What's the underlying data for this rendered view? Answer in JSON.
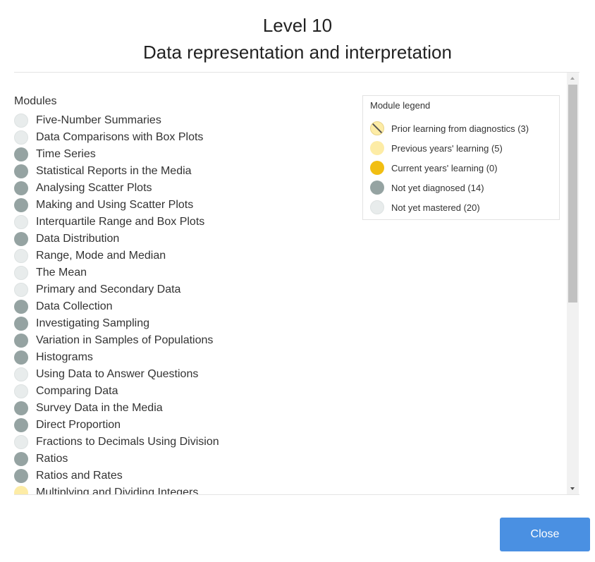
{
  "header": {
    "level_title": "Level 10",
    "subtitle": "Data representation and interpretation"
  },
  "modules": {
    "heading": "Modules",
    "items": [
      {
        "label": "Five-Number Summaries",
        "status": "not-mastered"
      },
      {
        "label": "Data Comparisons with Box Plots",
        "status": "not-mastered"
      },
      {
        "label": "Time Series",
        "status": "not-diagnosed"
      },
      {
        "label": "Statistical Reports in the Media",
        "status": "not-diagnosed"
      },
      {
        "label": "Analysing Scatter Plots",
        "status": "not-diagnosed"
      },
      {
        "label": "Making and Using Scatter Plots",
        "status": "not-diagnosed"
      },
      {
        "label": "Interquartile Range and Box Plots",
        "status": "not-mastered"
      },
      {
        "label": "Data Distribution",
        "status": "not-diagnosed"
      },
      {
        "label": "Range, Mode and Median",
        "status": "not-mastered"
      },
      {
        "label": "The Mean",
        "status": "not-mastered"
      },
      {
        "label": "Primary and Secondary Data",
        "status": "not-mastered"
      },
      {
        "label": "Data Collection",
        "status": "not-diagnosed"
      },
      {
        "label": "Investigating Sampling",
        "status": "not-diagnosed"
      },
      {
        "label": "Variation in Samples of Populations",
        "status": "not-diagnosed"
      },
      {
        "label": "Histograms",
        "status": "not-diagnosed"
      },
      {
        "label": "Using Data to Answer Questions",
        "status": "not-mastered"
      },
      {
        "label": "Comparing Data",
        "status": "not-mastered"
      },
      {
        "label": "Survey Data in the Media",
        "status": "not-diagnosed"
      },
      {
        "label": "Direct Proportion",
        "status": "not-diagnosed"
      },
      {
        "label": "Fractions to Decimals Using Division",
        "status": "not-mastered"
      },
      {
        "label": "Ratios",
        "status": "not-diagnosed"
      },
      {
        "label": "Ratios and Rates",
        "status": "not-diagnosed"
      },
      {
        "label": "Multiplying and Dividing Integers",
        "status": "previous"
      }
    ]
  },
  "legend": {
    "title": "Module legend",
    "items": [
      {
        "label": "Prior learning from diagnostics (3)",
        "status": "prior"
      },
      {
        "label": "Previous years' learning (5)",
        "status": "previous"
      },
      {
        "label": "Current years' learning (0)",
        "status": "current"
      },
      {
        "label": "Not yet diagnosed (14)",
        "status": "not-diagnosed"
      },
      {
        "label": "Not yet mastered (20)",
        "status": "not-mastered"
      }
    ]
  },
  "colors": {
    "not_mastered": "#e8ecec",
    "not_diagnosed": "#95a3a2",
    "previous": "#fdeca6",
    "current": "#f1be12",
    "close_button": "#4a90e2"
  },
  "footer": {
    "close_label": "Close"
  }
}
